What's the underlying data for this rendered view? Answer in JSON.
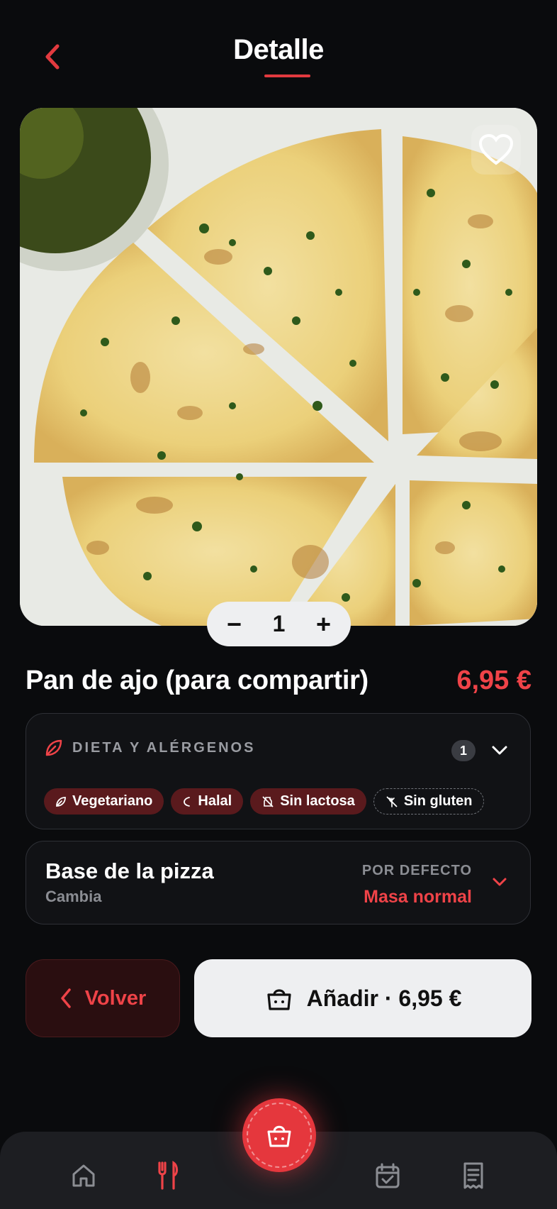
{
  "header": {
    "title": "Detalle"
  },
  "product": {
    "name": "Pan de ajo (para compartir)",
    "price": "6,95 €",
    "quantity": "1",
    "decrement_label": "−",
    "increment_label": "+"
  },
  "diet": {
    "title": "DIETA Y ALÉRGENOS",
    "count": "1",
    "chips": [
      {
        "label": "Vegetariano",
        "icon": "leaf-icon"
      },
      {
        "label": "Halal",
        "icon": "crescent-icon"
      },
      {
        "label": "Sin lactosa",
        "icon": "no-milk-icon"
      },
      {
        "label": "Sin gluten",
        "icon": "no-wheat-icon"
      }
    ]
  },
  "base": {
    "title": "Base de la pizza",
    "subtitle": "Cambia",
    "default_label": "POR DEFECTO",
    "value": "Masa normal"
  },
  "actions": {
    "back_label": "Volver",
    "add_label": "Añadir · 6,95 €"
  },
  "nav": {
    "items": [
      "home-icon",
      "restaurant-icon",
      "cart-icon",
      "calendar-icon",
      "receipt-icon"
    ]
  },
  "colors": {
    "accent": "#ef4348",
    "background": "#0a0b0d",
    "card": "#111215"
  }
}
